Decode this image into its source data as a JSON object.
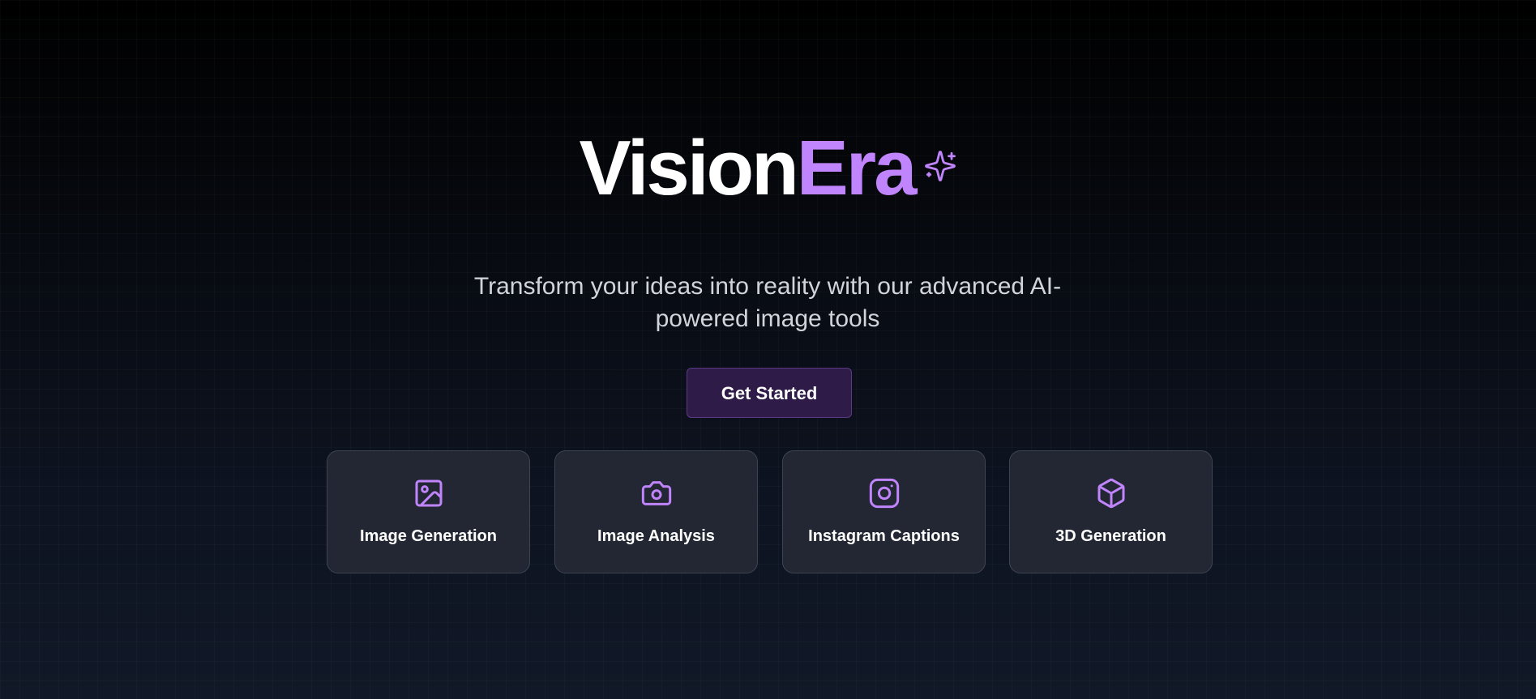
{
  "brand": {
    "name_part_1": "Vision",
    "name_part_2": "Era",
    "accent_color": "#c084fc",
    "sparkle_icon": "sparkles-icon"
  },
  "hero": {
    "tagline": "Transform your ideas into reality with our advanced AI-powered image tools",
    "cta_label": "Get Started"
  },
  "features": [
    {
      "label": "Image Generation",
      "icon": "image-icon"
    },
    {
      "label": "Image Analysis",
      "icon": "camera-icon"
    },
    {
      "label": "Instagram Captions",
      "icon": "instagram-icon"
    },
    {
      "label": "3D Generation",
      "icon": "cube-icon"
    }
  ],
  "colors": {
    "background_top": "#000000",
    "background_bottom": "#111827",
    "card_bg": "#232733",
    "cta_bg": "#2e1b48",
    "cta_border": "#5b3a85"
  }
}
